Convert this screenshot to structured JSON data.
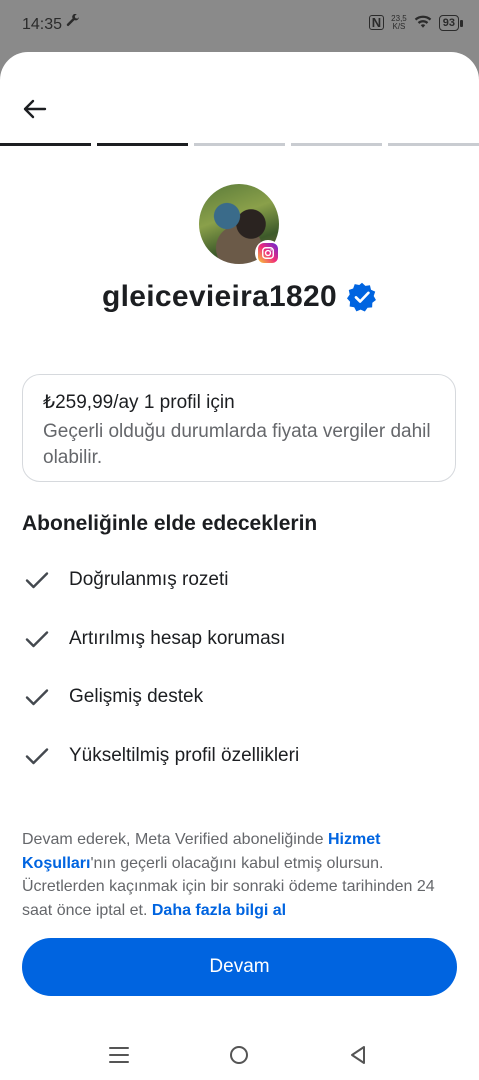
{
  "status_bar": {
    "time": "14:35",
    "network_speed_value": "23,5",
    "network_speed_unit": "K/S",
    "battery": "93"
  },
  "progress": {
    "total_steps": 5,
    "completed_steps": 2
  },
  "profile": {
    "username": "gleicevieira1820",
    "verified": true,
    "platform_icon": "instagram-icon"
  },
  "price_card": {
    "price_line": "₺259,99/ay 1 profil için",
    "tax_note": "Geçerli olduğu durumlarda fiyata vergiler dahil olabilir."
  },
  "benefits": {
    "title": "Aboneliğinle elde edeceklerin",
    "items": [
      {
        "label": "Doğrulanmış rozeti"
      },
      {
        "label": "Artırılmış hesap koruması"
      },
      {
        "label": "Gelişmiş destek"
      },
      {
        "label": "Yükseltilmiş profil özellikleri"
      }
    ]
  },
  "terms": {
    "part1": "Devam ederek, Meta Verified aboneliğinde ",
    "link1": "Hizmet Koşulları",
    "part2": "'nın geçerli olacağını kabul etmiş olursun. Ücretlerden kaçınmak için bir sonraki ödeme tarihinden 24 saat önce iptal et. ",
    "link2": "Daha fazla bilgi al"
  },
  "continue_button": {
    "label": "Devam"
  },
  "colors": {
    "accent": "#0064e0",
    "verified_badge": "#0064e0",
    "text_primary": "#1c1e21",
    "text_secondary": "#65676b"
  }
}
